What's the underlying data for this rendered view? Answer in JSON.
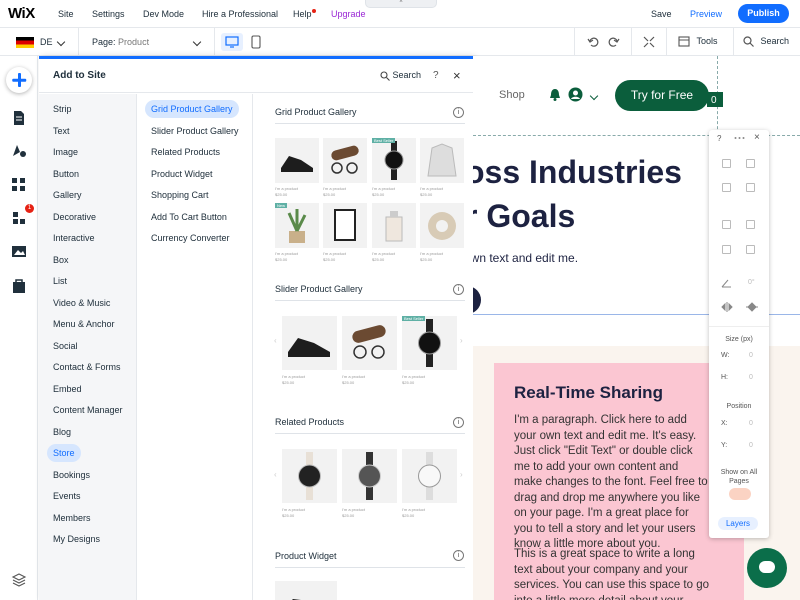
{
  "topbar": {
    "logo": "WiX",
    "nav": [
      "Site",
      "Settings",
      "Dev Mode",
      "Hire a Professional",
      "Help",
      "Upgrade"
    ],
    "save": "Save",
    "preview": "Preview",
    "publish": "Publish",
    "tab_glyph": "^"
  },
  "secbar": {
    "lang": "DE",
    "page_prefix": "Page:",
    "page": "Product",
    "tools": "Tools",
    "search": "Search"
  },
  "leftbar": {
    "notification_count": "1"
  },
  "panel": {
    "title": "Add to Site",
    "search": "Search",
    "help": "?",
    "close": "×",
    "categories": [
      "Strip",
      "Text",
      "Image",
      "Button",
      "Gallery",
      "Decorative",
      "Interactive",
      "Box",
      "List",
      "Video & Music",
      "Menu & Anchor",
      "Social",
      "Contact & Forms",
      "Embed",
      "Content Manager",
      "Blog",
      "Store",
      "Bookings",
      "Events",
      "Members",
      "My Designs"
    ],
    "selected_category": "Store",
    "subcategories": [
      "Grid Product Gallery",
      "Slider Product Gallery",
      "Related Products",
      "Product Widget",
      "Shopping Cart",
      "Add To Cart Button",
      "Currency Converter"
    ],
    "selected_subcategory": "Grid Product Gallery",
    "sections": [
      "Grid Product Gallery",
      "Slider Product Gallery",
      "Related Products",
      "Product Widget"
    ],
    "info": "i",
    "product_caption": "I'm a product",
    "price": "$25.00",
    "badge": "Best Seller",
    "badge2": "New",
    "arrow_left": "‹",
    "arrow_right": "›"
  },
  "site": {
    "nav_shop": "Shop",
    "cta": "Try for Free",
    "hero_line1": "oss Industries",
    "hero_line2": "r Goals",
    "hero_sub": "own text and edit me.",
    "card_title": "Real-Time Sharing",
    "card_p1": "I'm a paragraph. Click here to add your own text and edit me. It's easy. Just click \"Edit Text\" or double click me to add your own content and make changes to the font. Feel free to drag and drop me anywhere you like on your page. I'm a great place for you to tell a story and let your users know a little more about you.",
    "card_p2": "This is a great space to write a long text about your company and your services. You can use this space to go into a little more detail about your company. Talk"
  },
  "toolpanel": {
    "help": "?",
    "close": "×",
    "angle": "0°",
    "size_label": "Size (px)",
    "w": "W:",
    "h": "H:",
    "w_val": "0",
    "h_val": "0",
    "pos_label": "Position",
    "x": "X:",
    "y": "Y:",
    "x_val": "0",
    "y_val": "0",
    "show_all": "Show on All Pages",
    "layers": "Layers"
  },
  "colors": {
    "accent": "#116dff",
    "brand_green": "#0b5e3c",
    "pink": "#fbc6d2"
  }
}
